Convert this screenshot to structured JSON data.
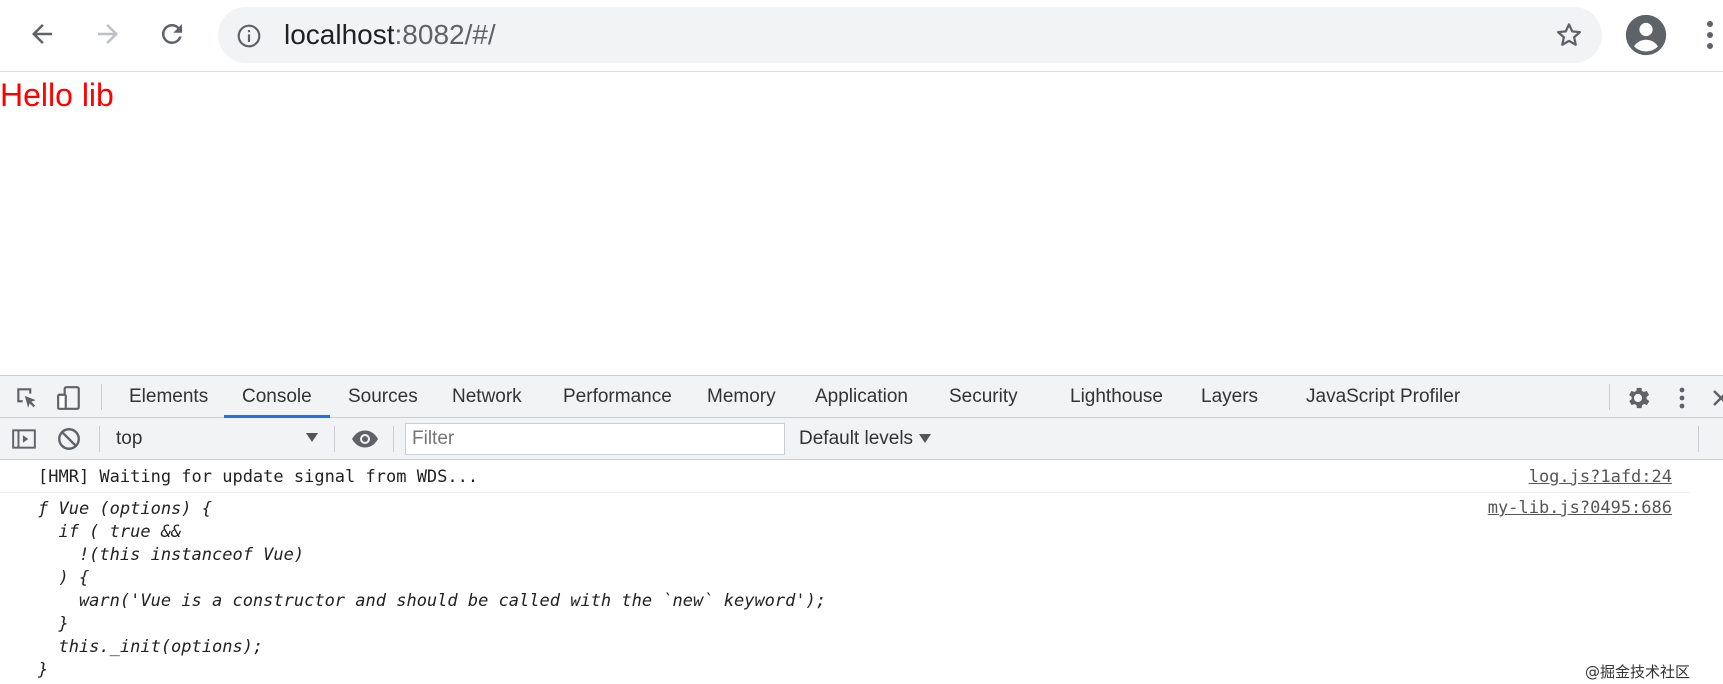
{
  "browser": {
    "url_host": "localhost",
    "url_rest": ":8082/#/",
    "icons": [
      "back-arrow-icon",
      "forward-arrow-icon",
      "reload-icon",
      "info-icon",
      "star-icon",
      "account-icon",
      "more-vert-icon"
    ]
  },
  "page": {
    "heading": "Hello lib",
    "heading_color": "#ff0000"
  },
  "devtools": {
    "tabs": [
      "Elements",
      "Console",
      "Sources",
      "Network",
      "Performance",
      "Memory",
      "Application",
      "Security",
      "Lighthouse",
      "Layers",
      "JavaScript Profiler"
    ],
    "active_tab": "Console",
    "context": "top",
    "filter_placeholder": "Filter",
    "levels_label": "Default levels",
    "accent_color": "#1a73e8"
  },
  "console": {
    "messages": [
      {
        "text": "[HMR] Waiting for update signal from WDS...",
        "source": "log.js?1afd:24"
      },
      {
        "lines": [
          "ƒ Vue (options) {",
          "  if ( true &&",
          "    !(this instanceof Vue)",
          "  ) {",
          "    warn('Vue is a constructor and should be called with the `new` keyword');",
          "  }",
          "  this._init(options);",
          "}"
        ],
        "source": "my-lib.js?0495:686"
      }
    ]
  },
  "watermark": "@掘金技术社区"
}
